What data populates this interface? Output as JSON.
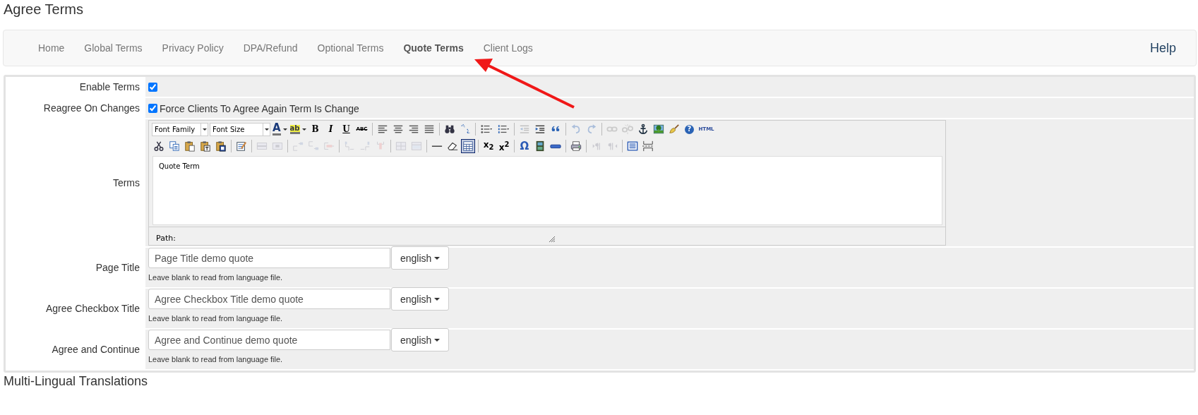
{
  "page_title": "Agree Terms",
  "nav": {
    "tabs": [
      {
        "label": "Home",
        "selected": false
      },
      {
        "label": "Global Terms",
        "selected": false
      },
      {
        "label": "Privacy Policy",
        "selected": false
      },
      {
        "label": "DPA/Refund",
        "selected": false
      },
      {
        "label": "Optional Terms",
        "selected": false
      },
      {
        "label": "Quote Terms",
        "selected": true
      },
      {
        "label": "Client Logs",
        "selected": false
      }
    ],
    "help": "Help"
  },
  "form": {
    "rows": [
      {
        "kind": "checkbox",
        "label": "Enable Terms",
        "checked": true
      },
      {
        "kind": "checkbox",
        "label": "Reagree On Changes",
        "checked": true,
        "text": "Force Clients To Agree Again Term Is Change"
      },
      {
        "kind": "editor",
        "label": "Terms",
        "editor": {
          "selects": [
            "Font Family",
            "Font Size"
          ],
          "toolbar": [
            [
              [
                {
                  "kind": "forecolor",
                  "label": "A",
                  "disabled": false,
                  "active": false
                },
                {
                  "kind": "backcolor",
                  "label": "ab",
                  "disabled": false,
                  "active": false
                },
                {
                  "kind": "bold",
                  "label": "B",
                  "disabled": false,
                  "active": false
                },
                {
                  "kind": "italic",
                  "label": "I",
                  "disabled": false,
                  "active": false
                },
                {
                  "kind": "underline",
                  "label": "U",
                  "disabled": false,
                  "active": false
                },
                {
                  "kind": "strike",
                  "label": "ABC",
                  "disabled": false,
                  "active": false
                }
              ],
              [
                {
                  "kind": "alignleft",
                  "disabled": false,
                  "active": false
                },
                {
                  "kind": "aligncenter",
                  "disabled": false,
                  "active": false
                },
                {
                  "kind": "alignright",
                  "disabled": false,
                  "active": false
                },
                {
                  "kind": "justify",
                  "disabled": false,
                  "active": false
                }
              ],
              [
                {
                  "kind": "find",
                  "disabled": false,
                  "active": false
                },
                {
                  "kind": "replace",
                  "disabled": false,
                  "active": false
                }
              ],
              [
                {
                  "kind": "bullist",
                  "disabled": false,
                  "active": false
                },
                {
                  "kind": "numlist",
                  "disabled": false,
                  "active": false
                }
              ],
              [
                {
                  "kind": "outdent",
                  "disabled": true,
                  "active": false
                },
                {
                  "kind": "indent",
                  "disabled": false,
                  "active": false
                },
                {
                  "kind": "blockquote",
                  "disabled": false,
                  "active": false
                }
              ],
              [
                {
                  "kind": "undo",
                  "disabled": true,
                  "active": false
                },
                {
                  "kind": "redo",
                  "disabled": true,
                  "active": false
                }
              ],
              [
                {
                  "kind": "link",
                  "disabled": true,
                  "active": false
                },
                {
                  "kind": "unlink",
                  "disabled": true,
                  "active": false
                },
                {
                  "kind": "anchor",
                  "disabled": false,
                  "active": false
                },
                {
                  "kind": "image",
                  "disabled": false,
                  "active": false
                },
                {
                  "kind": "cleanup",
                  "disabled": false,
                  "active": false
                },
                {
                  "kind": "help",
                  "label": "?",
                  "disabled": false,
                  "active": false
                },
                {
                  "kind": "code",
                  "label": "HTML",
                  "disabled": false,
                  "active": false
                }
              ]
            ],
            [
              [
                {
                  "kind": "cut",
                  "disabled": false,
                  "active": false
                },
                {
                  "kind": "copy",
                  "disabled": false,
                  "active": false
                },
                {
                  "kind": "paste",
                  "disabled": false,
                  "active": false
                },
                {
                  "kind": "pastetext",
                  "disabled": false,
                  "active": false
                },
                {
                  "kind": "pasteword",
                  "disabled": false,
                  "active": false
                }
              ],
              [
                {
                  "kind": "table",
                  "disabled": false,
                  "active": false
                }
              ],
              [
                {
                  "kind": "rowprops",
                  "disabled": true,
                  "active": false
                },
                {
                  "kind": "cellprops",
                  "disabled": true,
                  "active": false
                }
              ],
              [
                {
                  "kind": "rowbefore",
                  "disabled": true,
                  "active": false
                },
                {
                  "kind": "rowafter",
                  "disabled": true,
                  "active": false
                },
                {
                  "kind": "deleterow",
                  "disabled": true,
                  "active": false
                }
              ],
              [
                {
                  "kind": "colbefore",
                  "disabled": true,
                  "active": false
                },
                {
                  "kind": "colafter",
                  "disabled": true,
                  "active": false
                },
                {
                  "kind": "deletecol",
                  "disabled": true,
                  "active": false
                }
              ],
              [
                {
                  "kind": "splitcells",
                  "disabled": true,
                  "active": false
                },
                {
                  "kind": "mergecells",
                  "disabled": true,
                  "active": false
                }
              ],
              [
                {
                  "kind": "hr",
                  "disabled": false,
                  "active": false
                },
                {
                  "kind": "removeformat",
                  "disabled": false,
                  "active": false
                },
                {
                  "kind": "visualaid",
                  "disabled": false,
                  "active": true
                }
              ],
              [
                {
                  "kind": "sub",
                  "label": "x$_{2}$",
                  "disabled": false,
                  "active": false
                },
                {
                  "kind": "sup",
                  "label": "x$^{2}$",
                  "disabled": false,
                  "active": false
                }
              ],
              [
                {
                  "kind": "charmap",
                  "label": "Ω",
                  "disabled": false,
                  "active": false
                },
                {
                  "kind": "media",
                  "disabled": false,
                  "active": false
                },
                {
                  "kind": "hrule",
                  "disabled": false,
                  "active": false
                }
              ],
              [
                {
                  "kind": "print",
                  "disabled": false,
                  "active": false
                }
              ],
              [
                {
                  "kind": "ltr",
                  "disabled": true,
                  "active": false
                },
                {
                  "kind": "rtl",
                  "disabled": true,
                  "active": false
                }
              ],
              [
                {
                  "kind": "fullscreen",
                  "disabled": false,
                  "active": false
                },
                {
                  "kind": "pagebreak",
                  "disabled": false,
                  "active": false
                }
              ]
            ]
          ],
          "content": "Quote Term",
          "path_label": "Path:"
        }
      },
      {
        "kind": "translated",
        "label": "Page Title",
        "value": "Page Title demo quote",
        "language": "english",
        "help": "Leave blank to read from language file."
      },
      {
        "kind": "translated",
        "label": "Agree Checkbox Title",
        "value": "Agree Checkbox Title demo quote",
        "language": "english",
        "help": "Leave blank to read from language file."
      },
      {
        "kind": "translated",
        "label": "Agree and Continue",
        "value": "Agree and Continue demo quote",
        "language": "english",
        "help": "Leave blank to read from language file."
      }
    ]
  },
  "section_heading": "Multi-Lingual Translations"
}
